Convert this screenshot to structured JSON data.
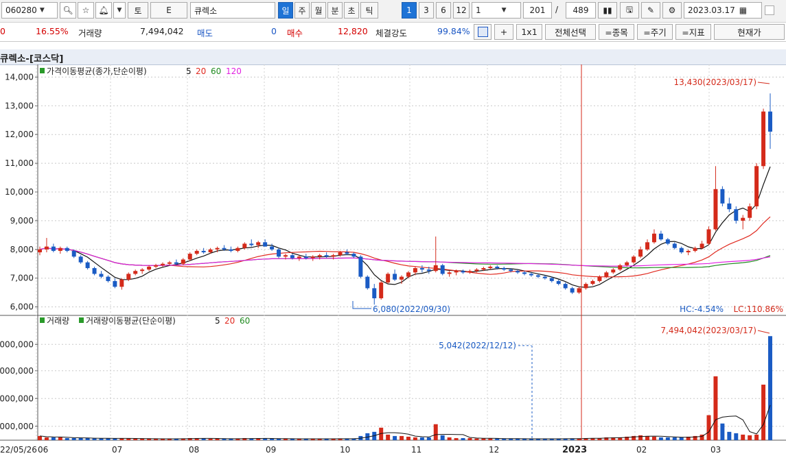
{
  "toolbar": {
    "code": "060280",
    "btn_to": "토",
    "btn_e": "E",
    "name": "큐렉소",
    "periods": [
      "일",
      "주",
      "월",
      "분",
      "초",
      "틱"
    ],
    "nums": [
      "1",
      "3",
      "6",
      "12"
    ],
    "unit": "1",
    "count_a": "201",
    "slash": "/",
    "count_b": "489",
    "date": "2023.03.17"
  },
  "info": {
    "left_val": "0",
    "change_pct": "16.55%",
    "volume_label": "거래량",
    "volume_value": "7,494,042",
    "sell_label": "매도",
    "sell_value": "0",
    "buy_label": "매수",
    "buy_value": "12,820",
    "strength_label": "체결강도",
    "strength_value": "99.84%",
    "plus": "+",
    "one_by_one": "1x1",
    "select_all": "전체선택",
    "item_btn": "=종목",
    "period_btn": "=주기",
    "indicator_btn": "=지표",
    "current_btn": "현재가"
  },
  "title": "큐렉소-[코스닥]",
  "colors": {
    "up": "#d42a1a",
    "down": "#1a5bc4",
    "ma5": "#111111",
    "ma20": "#e0281e",
    "ma60": "#1e8a1e",
    "ma120": "#e01ee0"
  },
  "chart_data": {
    "type": "candlestick",
    "price_panel": {
      "legend_prefix": "가격이동평균(종가,단순이평)",
      "ma_periods": [
        "5",
        "20",
        "60",
        "120"
      ],
      "y_ticks": [
        "14,000",
        "13,000",
        "12,000",
        "11,000",
        "10,000",
        "9,000",
        "8,000",
        "7,000",
        "6,000"
      ],
      "ylim": [
        5800,
        14200
      ],
      "high_annotation": "13,430(2023/03/17)",
      "low_annotation": "6,080(2022/09/30)",
      "hc": "HC:-4.54%",
      "lc": "LC:110.86%"
    },
    "volume_panel": {
      "legend_1": "거래량",
      "legend_2": "거래량이동평균(단순이평)",
      "ma_periods": [
        "5",
        "20",
        "60"
      ],
      "y_ticks": [
        "000,000",
        "000,000",
        "000,000",
        "000,000"
      ],
      "high_annotation": "7,494,042(2023/03/17)",
      "cursor_annotation": "5,042(2022/12/12)"
    },
    "x_labels": [
      "22/05/26",
      "06",
      "07",
      "08",
      "09",
      "10",
      "11",
      "12",
      "2023",
      "02",
      "03"
    ],
    "candles": [
      [
        7900,
        8100,
        7800,
        8000
      ],
      [
        8000,
        8400,
        7900,
        8100
      ],
      [
        8100,
        8200,
        7900,
        7950
      ],
      [
        7950,
        8100,
        7850,
        8050
      ],
      [
        8050,
        8100,
        7900,
        7950
      ],
      [
        7950,
        8000,
        7700,
        7750
      ],
      [
        7750,
        7800,
        7500,
        7550
      ],
      [
        7550,
        7600,
        7300,
        7350
      ],
      [
        7350,
        7400,
        7100,
        7150
      ],
      [
        7150,
        7250,
        7000,
        7050
      ],
      [
        7050,
        7100,
        6850,
        6900
      ],
      [
        6900,
        7000,
        6650,
        6700
      ],
      [
        6700,
        7000,
        6600,
        6950
      ],
      [
        6950,
        7200,
        6900,
        7150
      ],
      [
        7150,
        7300,
        7100,
        7250
      ],
      [
        7250,
        7350,
        7150,
        7300
      ],
      [
        7300,
        7450,
        7250,
        7400
      ],
      [
        7400,
        7500,
        7350,
        7450
      ],
      [
        7450,
        7550,
        7400,
        7500
      ],
      [
        7500,
        7600,
        7450,
        7550
      ],
      [
        7550,
        7650,
        7450,
        7500
      ],
      [
        7500,
        7700,
        7450,
        7650
      ],
      [
        7650,
        7900,
        7600,
        7850
      ],
      [
        7850,
        8000,
        7800,
        7950
      ],
      [
        7950,
        8050,
        7850,
        7900
      ],
      [
        7900,
        8050,
        7850,
        8000
      ],
      [
        8000,
        8100,
        7900,
        8050
      ],
      [
        8050,
        8150,
        7950,
        8000
      ],
      [
        8000,
        8100,
        7900,
        7950
      ],
      [
        7950,
        8100,
        7900,
        8050
      ],
      [
        8050,
        8250,
        8000,
        8200
      ],
      [
        8200,
        8350,
        8100,
        8150
      ],
      [
        8150,
        8300,
        8050,
        8250
      ],
      [
        8250,
        8350,
        8100,
        8100
      ],
      [
        8100,
        8200,
        7950,
        8000
      ],
      [
        8000,
        8050,
        7700,
        7750
      ],
      [
        7750,
        7850,
        7650,
        7800
      ],
      [
        7800,
        7850,
        7650,
        7700
      ],
      [
        7700,
        7800,
        7600,
        7750
      ],
      [
        7750,
        7850,
        7650,
        7700
      ],
      [
        7700,
        7800,
        7600,
        7750
      ],
      [
        7750,
        7850,
        7650,
        7800
      ],
      [
        7800,
        7900,
        7700,
        7750
      ],
      [
        7750,
        7850,
        7650,
        7800
      ],
      [
        7800,
        7950,
        7750,
        7900
      ],
      [
        7900,
        8000,
        7800,
        7850
      ],
      [
        7850,
        7900,
        7700,
        7750
      ],
      [
        7750,
        7800,
        7000,
        7050
      ],
      [
        7050,
        7100,
        6600,
        6650
      ],
      [
        6650,
        6800,
        6080,
        6300
      ],
      [
        6300,
        6900,
        6250,
        6850
      ],
      [
        6850,
        7200,
        6800,
        7150
      ],
      [
        7150,
        7300,
        6900,
        6950
      ],
      [
        6950,
        7100,
        6800,
        7050
      ],
      [
        7050,
        7250,
        7000,
        7200
      ],
      [
        7200,
        7400,
        7100,
        7350
      ],
      [
        7350,
        7450,
        7200,
        7300
      ],
      [
        7300,
        7400,
        7150,
        7250
      ],
      [
        7250,
        8450,
        7200,
        7450
      ],
      [
        7450,
        7500,
        7100,
        7150
      ],
      [
        7150,
        7250,
        7050,
        7200
      ],
      [
        7200,
        7300,
        7100,
        7250
      ],
      [
        7250,
        7300,
        7150,
        7200
      ],
      [
        7200,
        7300,
        7150,
        7250
      ],
      [
        7250,
        7350,
        7200,
        7300
      ],
      [
        7300,
        7400,
        7250,
        7350
      ],
      [
        7350,
        7450,
        7300,
        7400
      ],
      [
        7400,
        7450,
        7300,
        7350
      ],
      [
        7350,
        7400,
        7250,
        7300
      ],
      [
        7300,
        7350,
        7200,
        7250
      ],
      [
        7250,
        7300,
        7150,
        7200
      ],
      [
        7200,
        7250,
        7100,
        7150
      ],
      [
        7150,
        7200,
        7050,
        7100
      ],
      [
        7100,
        7150,
        7000,
        7050
      ],
      [
        7050,
        7100,
        6950,
        7000
      ],
      [
        7000,
        7050,
        6850,
        6900
      ],
      [
        6900,
        6950,
        6750,
        6800
      ],
      [
        6800,
        6850,
        6600,
        6650
      ],
      [
        6650,
        6700,
        6450,
        6500
      ],
      [
        6500,
        6700,
        6450,
        6650
      ],
      [
        6650,
        6850,
        6600,
        6800
      ],
      [
        6800,
        6950,
        6750,
        6900
      ],
      [
        6900,
        7100,
        6850,
        7050
      ],
      [
        7050,
        7250,
        7000,
        7200
      ],
      [
        7200,
        7350,
        7150,
        7300
      ],
      [
        7300,
        7500,
        7250,
        7450
      ],
      [
        7450,
        7600,
        7400,
        7550
      ],
      [
        7550,
        7800,
        7500,
        7750
      ],
      [
        7750,
        8100,
        7700,
        8000
      ],
      [
        8000,
        8350,
        7950,
        8250
      ],
      [
        8250,
        8700,
        8200,
        8550
      ],
      [
        8550,
        8650,
        8300,
        8350
      ],
      [
        8350,
        8400,
        8150,
        8200
      ],
      [
        8200,
        8250,
        8000,
        8050
      ],
      [
        8050,
        8100,
        7850,
        7900
      ],
      [
        7900,
        8000,
        7800,
        7950
      ],
      [
        7950,
        8100,
        7900,
        8050
      ],
      [
        8050,
        8300,
        8000,
        8200
      ],
      [
        8200,
        8800,
        8150,
        8700
      ],
      [
        8700,
        10900,
        8650,
        10100
      ],
      [
        10100,
        10200,
        9500,
        9600
      ],
      [
        9600,
        9800,
        9300,
        9400
      ],
      [
        9400,
        9500,
        8900,
        9000
      ],
      [
        9000,
        9200,
        8700,
        9100
      ],
      [
        9100,
        9600,
        9000,
        9500
      ],
      [
        9500,
        11000,
        9400,
        10900
      ],
      [
        10900,
        12900,
        10800,
        12800
      ],
      [
        12800,
        13430,
        11500,
        12100
      ]
    ],
    "volumes": [
      0.3,
      0.2,
      0.2,
      0.2,
      0.15,
      0.15,
      0.15,
      0.15,
      0.12,
      0.12,
      0.12,
      0.12,
      0.15,
      0.12,
      0.1,
      0.1,
      0.1,
      0.1,
      0.1,
      0.1,
      0.1,
      0.12,
      0.15,
      0.15,
      0.12,
      0.1,
      0.1,
      0.1,
      0.1,
      0.12,
      0.15,
      0.12,
      0.12,
      0.12,
      0.1,
      0.1,
      0.1,
      0.1,
      0.1,
      0.1,
      0.1,
      0.1,
      0.1,
      0.1,
      0.12,
      0.1,
      0.1,
      0.3,
      0.5,
      0.6,
      0.9,
      0.4,
      0.3,
      0.3,
      0.25,
      0.2,
      0.2,
      0.2,
      1.15,
      0.35,
      0.2,
      0.15,
      0.15,
      0.15,
      0.12,
      0.12,
      0.12,
      0.12,
      0.1,
      0.1,
      0.1,
      0.1,
      0.1,
      0.1,
      0.1,
      0.1,
      0.1,
      0.12,
      0.12,
      0.12,
      0.15,
      0.15,
      0.15,
      0.2,
      0.2,
      0.2,
      0.25,
      0.3,
      0.35,
      0.3,
      0.25,
      0.2,
      0.2,
      0.2,
      0.2,
      0.25,
      0.3,
      0.4,
      1.8,
      4.6,
      1.2,
      0.6,
      0.5,
      0.4,
      0.35,
      0.4,
      4.0,
      7.494
    ],
    "volume_ylim": [
      0,
      8.0
    ]
  }
}
